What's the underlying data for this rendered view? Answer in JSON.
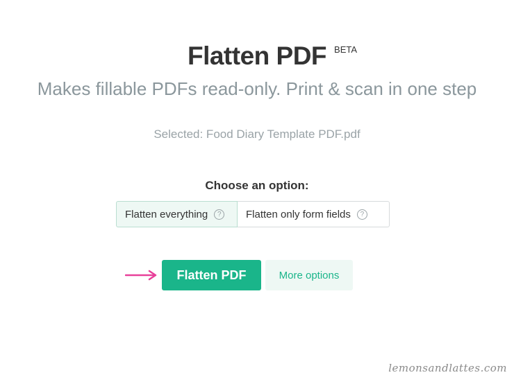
{
  "header": {
    "title": "Flatten PDF",
    "badge": "BETA",
    "subtitle": "Makes fillable PDFs read-only. Print & scan in one step"
  },
  "file": {
    "selected_text": "Selected: Food Diary Template PDF.pdf"
  },
  "options": {
    "heading": "Choose an option:",
    "items": [
      {
        "label": "Flatten everything",
        "help": "?",
        "selected": true
      },
      {
        "label": "Flatten only form fields",
        "help": "?",
        "selected": false
      }
    ]
  },
  "actions": {
    "primary_label": "Flatten PDF",
    "secondary_label": "More options"
  },
  "annotation": {
    "arrow_color": "#e8409a"
  },
  "watermark": {
    "text": "lemonsandlattes.com"
  },
  "colors": {
    "accent": "#1ab58a",
    "accent_light": "#eef8f4",
    "subtitle": "#8b979c"
  }
}
